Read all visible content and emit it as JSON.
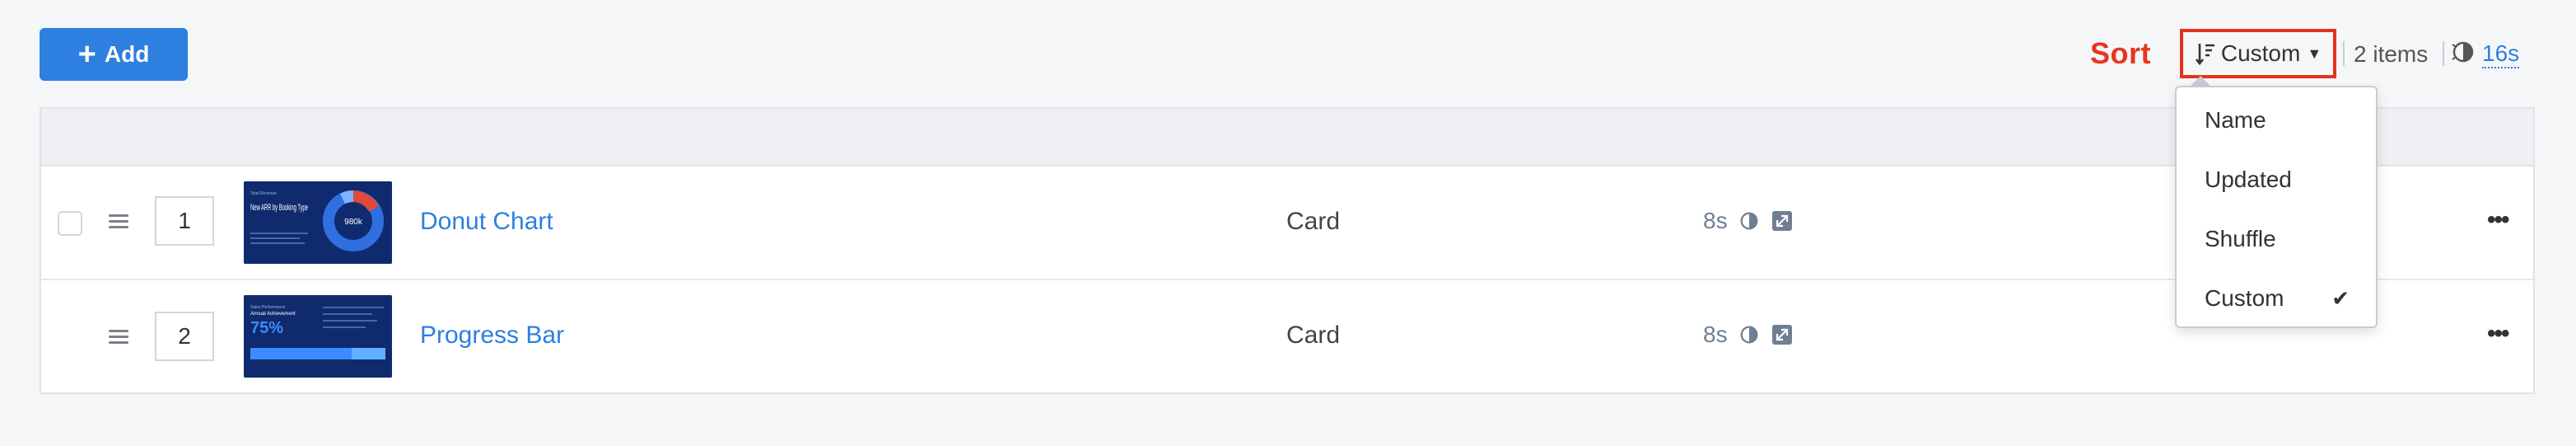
{
  "toolbar": {
    "add_label": "Add",
    "sort_annotation": "Sort",
    "sort_selected": "Custom",
    "items_count": "2 items",
    "refresh_label": "16s"
  },
  "sort_menu": {
    "options": [
      {
        "label": "Name",
        "checked": false
      },
      {
        "label": "Updated",
        "checked": false
      },
      {
        "label": "Shuffle",
        "checked": false
      },
      {
        "label": "Custom",
        "checked": true
      }
    ]
  },
  "rows": [
    {
      "order": "1",
      "name": "Donut Chart",
      "type": "Card",
      "duration": "8s",
      "thumb": {
        "title_top": "Total Revenue",
        "title": "New ARR by Booking Type",
        "center_value": "980k"
      }
    },
    {
      "order": "2",
      "name": "Progress Bar",
      "type": "Card",
      "duration": "8s",
      "thumb": {
        "title_top": "Sales Performance",
        "title": "Annual Achievement",
        "value": "75%"
      }
    }
  ],
  "colors": {
    "accent": "#2d7fe0",
    "annotation": "#e5321c",
    "thumb_bg": "#0f2b6e"
  },
  "icons": [
    "plus-icon",
    "sort-icon",
    "caret-down-icon",
    "timer-icon",
    "expand-icon",
    "check-icon",
    "more-icon",
    "drag-handle-icon"
  ]
}
